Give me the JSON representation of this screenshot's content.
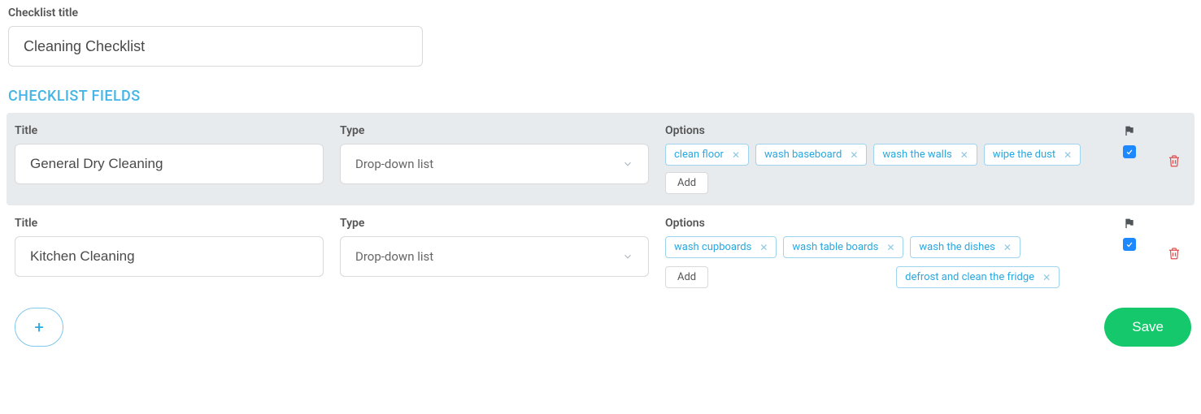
{
  "header": {
    "checklist_title_label": "Checklist title",
    "checklist_title_value": "Cleaning Checklist"
  },
  "section_heading": "CHECKLIST FIELDS",
  "columns": {
    "title": "Title",
    "type": "Type",
    "options": "Options"
  },
  "add_label": "Add",
  "save_label": "Save",
  "fields": [
    {
      "active": true,
      "title": "General Dry Cleaning",
      "type": "Drop-down list",
      "checked": true,
      "options": [
        "clean floor",
        "wash baseboard",
        "wash the walls",
        "wipe the dust"
      ],
      "options_row2": []
    },
    {
      "active": false,
      "title": "Kitchen Cleaning",
      "type": "Drop-down list",
      "checked": true,
      "options": [
        "wash cupboards",
        "wash table boards",
        "wash the dishes"
      ],
      "options_row2": [
        "defrost and clean the fridge"
      ]
    }
  ]
}
